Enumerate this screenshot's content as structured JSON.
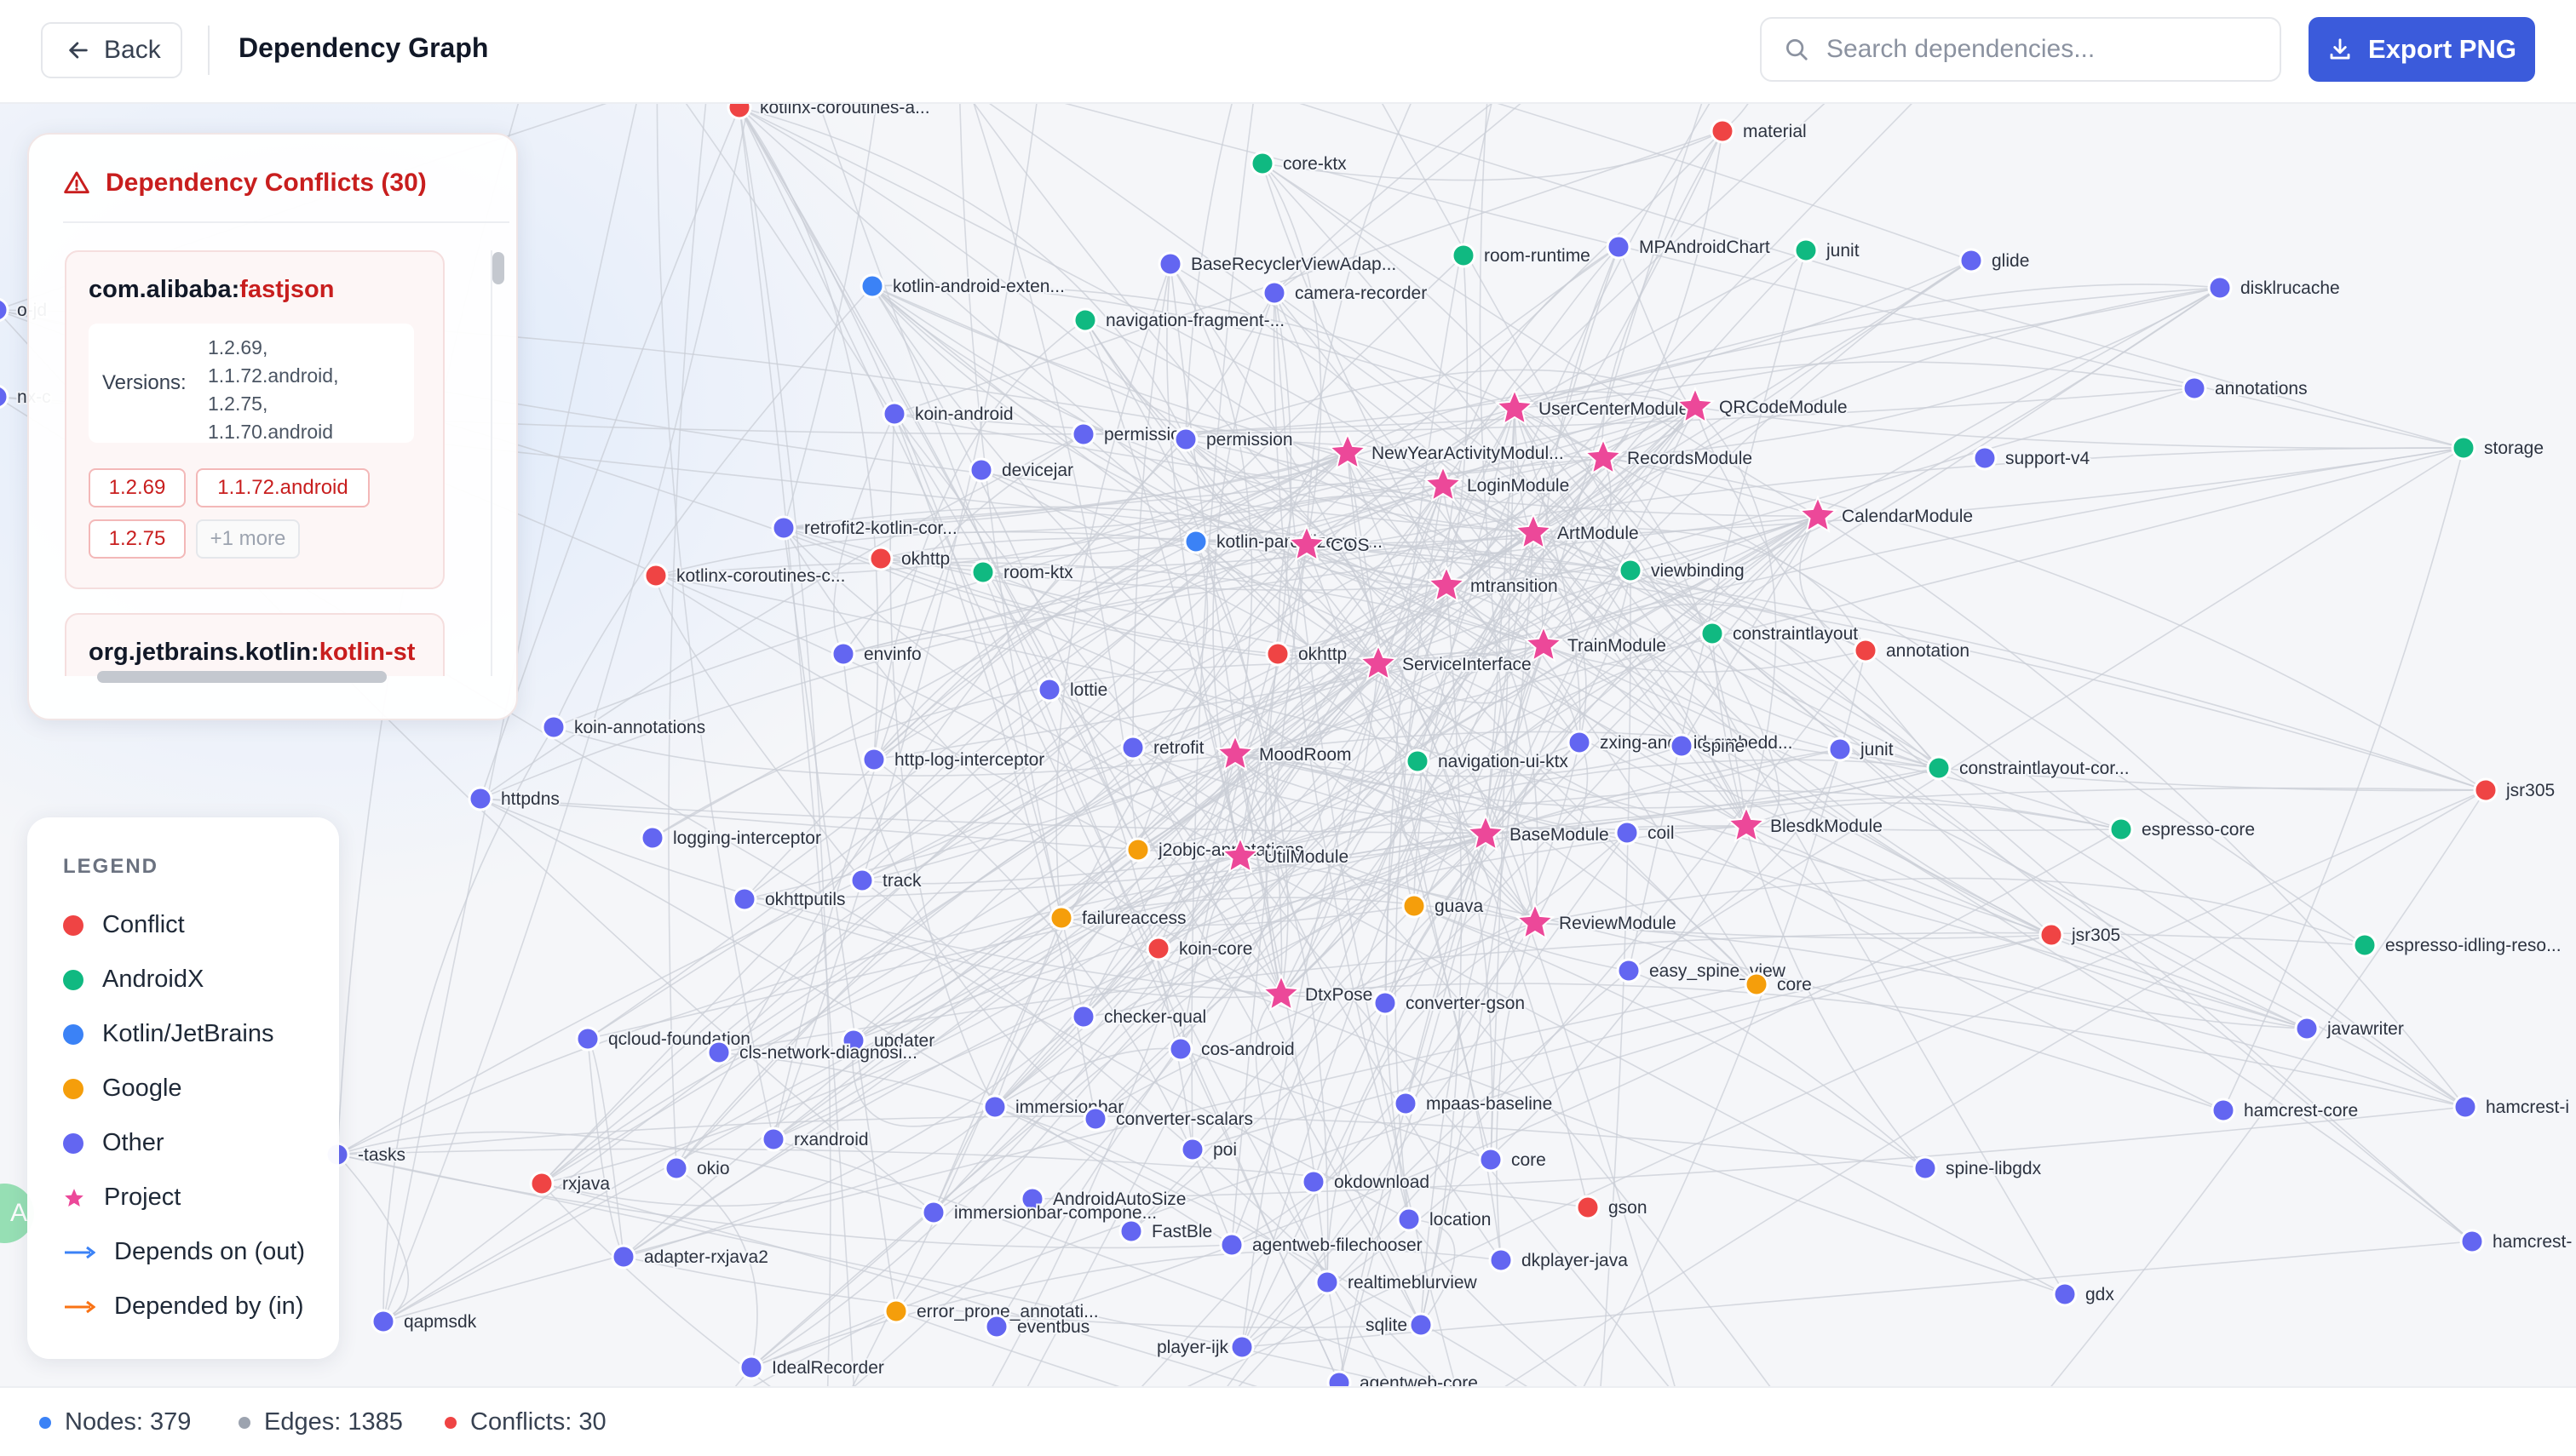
{
  "header": {
    "back_label": "Back",
    "title": "Dependency Graph",
    "search_placeholder": "Search dependencies...",
    "export_label": "Export PNG"
  },
  "colors": {
    "conflict": "#ef4444",
    "androidx": "#10b981",
    "kotlin": "#3b82f6",
    "google": "#f59e0b",
    "other": "#6366f1",
    "project": "#ec4899",
    "accent": "#3b5bdb"
  },
  "conflicts": {
    "title": "Dependency Conflicts (30)",
    "cards": [
      {
        "group": "com.alibaba:",
        "artifact": "fastjson",
        "versions_label": "Versions:",
        "versions": [
          "1.2.69,",
          "1.1.72.android,",
          "1.2.75,",
          "1.1.70.android"
        ],
        "chips": [
          "1.2.69",
          "1.1.72.android",
          "1.2.75"
        ],
        "more": "+1 more"
      },
      {
        "group": "org.jetbrains.kotlin:",
        "artifact": "kotlin-st"
      }
    ]
  },
  "legend": {
    "title": "LEGEND",
    "items": [
      {
        "kind": "dot",
        "color": "#ef4444",
        "label": "Conflict"
      },
      {
        "kind": "dot",
        "color": "#10b981",
        "label": "AndroidX"
      },
      {
        "kind": "dot",
        "color": "#3b82f6",
        "label": "Kotlin/JetBrains"
      },
      {
        "kind": "dot",
        "color": "#f59e0b",
        "label": "Google"
      },
      {
        "kind": "dot",
        "color": "#6366f1",
        "label": "Other"
      },
      {
        "kind": "star",
        "color": "#ec4899",
        "label": "Project"
      },
      {
        "kind": "arrow",
        "color": "#3b82f6",
        "label": "Depends on (out)"
      },
      {
        "kind": "arrow",
        "color": "#f97316",
        "label": "Depended by (in)"
      }
    ]
  },
  "status": {
    "nodes": "Nodes: 379",
    "edges": "Edges: 1385",
    "conflicts": "Conflicts: 30"
  },
  "side_bubble": "A",
  "graph": {
    "nodes": [
      {
        "label": "kotlinx-coroutines-a...",
        "type": "conflict"
      },
      {
        "label": "material",
        "type": "conflict"
      },
      {
        "label": "core-ktx",
        "type": "androidx"
      },
      {
        "label": "BaseRecyclerViewAdap...",
        "type": "other"
      },
      {
        "label": "room-runtime",
        "type": "androidx"
      },
      {
        "label": "MPAndroidChart",
        "type": "other"
      },
      {
        "label": "junit",
        "type": "androidx"
      },
      {
        "label": "glide",
        "type": "other"
      },
      {
        "label": "disklrucache",
        "type": "other"
      },
      {
        "label": "kotlin-android-exten...",
        "type": "kotlin"
      },
      {
        "label": "camera-recorder",
        "type": "other"
      },
      {
        "label": "navigation-fragment-...",
        "type": "androidx"
      },
      {
        "label": "annotations",
        "type": "other"
      },
      {
        "label": "storage",
        "type": "androidx"
      },
      {
        "label": "koin-android",
        "type": "other"
      },
      {
        "label": "UserCenterModule",
        "type": "project"
      },
      {
        "label": "QRCodeModule",
        "type": "project"
      },
      {
        "label": "permission",
        "type": "other"
      },
      {
        "label": "permission",
        "type": "other"
      },
      {
        "label": "NewYearActivityModul...",
        "type": "project"
      },
      {
        "label": "RecordsModule",
        "type": "project"
      },
      {
        "label": "support-v4",
        "type": "other"
      },
      {
        "label": "devicejar",
        "type": "other"
      },
      {
        "label": "LoginModule",
        "type": "project"
      },
      {
        "label": "CalendarModule",
        "type": "project"
      },
      {
        "label": "retrofit2-kotlin-cor...",
        "type": "other"
      },
      {
        "label": "ArtModule",
        "type": "project"
      },
      {
        "label": "kotlin-parcelize-run...",
        "type": "kotlin"
      },
      {
        "label": "COS",
        "type": "project"
      },
      {
        "label": "okhttp",
        "type": "conflict"
      },
      {
        "label": "kotlinx-coroutines-c...",
        "type": "conflict"
      },
      {
        "label": "room-ktx",
        "type": "androidx"
      },
      {
        "label": "viewbinding",
        "type": "androidx"
      },
      {
        "label": "mtransition",
        "type": "project"
      },
      {
        "label": "constraintlayout",
        "type": "androidx"
      },
      {
        "label": "envinfo",
        "type": "other"
      },
      {
        "label": "okhttp",
        "type": "conflict"
      },
      {
        "label": "ServiceInterface",
        "type": "project"
      },
      {
        "label": "TrainModule",
        "type": "project"
      },
      {
        "label": "annotation",
        "type": "conflict"
      },
      {
        "label": "lottie",
        "type": "other"
      },
      {
        "label": "koin-annotations",
        "type": "other"
      },
      {
        "label": "retrofit",
        "type": "other"
      },
      {
        "label": "MoodRoom",
        "type": "project"
      },
      {
        "label": "navigation-ui-ktx",
        "type": "androidx"
      },
      {
        "label": "zxing-android-embedd...",
        "type": "other"
      },
      {
        "label": "spine",
        "type": "other"
      },
      {
        "label": "junit",
        "type": "other"
      },
      {
        "label": "constraintlayout-cor...",
        "type": "androidx"
      },
      {
        "label": "http-log-interceptor",
        "type": "other"
      },
      {
        "label": "httpdns",
        "type": "other"
      },
      {
        "label": "jsr305",
        "type": "conflict"
      },
      {
        "label": "logging-interceptor",
        "type": "other"
      },
      {
        "label": "j2objc-annotations",
        "type": "google"
      },
      {
        "label": "UtilModule",
        "type": "project"
      },
      {
        "label": "BaseModule",
        "type": "project"
      },
      {
        "label": "coil",
        "type": "other"
      },
      {
        "label": "BlesdkModule",
        "type": "project"
      },
      {
        "label": "espresso-core",
        "type": "androidx"
      },
      {
        "label": "track",
        "type": "other"
      },
      {
        "label": "okhttputils",
        "type": "other"
      },
      {
        "label": "guava",
        "type": "google"
      },
      {
        "label": "failureaccess",
        "type": "google"
      },
      {
        "label": "ReviewModule",
        "type": "project"
      },
      {
        "label": "jsr305",
        "type": "conflict"
      },
      {
        "label": "espresso-idling-reso...",
        "type": "androidx"
      },
      {
        "label": "koin-core",
        "type": "conflict"
      },
      {
        "label": "easy_spine_view",
        "type": "other"
      },
      {
        "label": "core",
        "type": "google"
      },
      {
        "label": "DtxPose",
        "type": "project"
      },
      {
        "label": "converter-gson",
        "type": "other"
      },
      {
        "label": "checker-qual",
        "type": "other"
      },
      {
        "label": "javawriter",
        "type": "other"
      },
      {
        "label": "qcloud-foundation",
        "type": "other"
      },
      {
        "label": "updater",
        "type": "other"
      },
      {
        "label": "cls-network-diagnosi...",
        "type": "other"
      },
      {
        "label": "cos-android",
        "type": "other"
      },
      {
        "label": "immersionbar",
        "type": "other"
      },
      {
        "label": "mpaas-baseline",
        "type": "other"
      },
      {
        "label": "converter-scalars",
        "type": "other"
      },
      {
        "label": "hamcrest-core",
        "type": "other"
      },
      {
        "label": "hamcrest-i",
        "type": "other"
      },
      {
        "label": "-tasks",
        "type": "other"
      },
      {
        "label": "rxandroid",
        "type": "other"
      },
      {
        "label": "poi",
        "type": "other"
      },
      {
        "label": "core",
        "type": "other"
      },
      {
        "label": "rxjava",
        "type": "conflict"
      },
      {
        "label": "okio",
        "type": "other"
      },
      {
        "label": "okdownload",
        "type": "other"
      },
      {
        "label": "spine-libgdx",
        "type": "other"
      },
      {
        "label": "AndroidAutoSize",
        "type": "other"
      },
      {
        "label": "immersionbar-compone...",
        "type": "other"
      },
      {
        "label": "location",
        "type": "other"
      },
      {
        "label": "gson",
        "type": "conflict"
      },
      {
        "label": "FastBle",
        "type": "other"
      },
      {
        "label": "agentweb-filechooser",
        "type": "other"
      },
      {
        "label": "hamcrest-",
        "type": "other"
      },
      {
        "label": "adapter-rxjava2",
        "type": "other"
      },
      {
        "label": "dkplayer-java",
        "type": "other"
      },
      {
        "label": "realtimeblurview",
        "type": "other"
      },
      {
        "label": "gdx",
        "type": "other"
      },
      {
        "label": "qapmsdk",
        "type": "other"
      },
      {
        "label": "error_prone_annotati...",
        "type": "google"
      },
      {
        "label": "eventbus",
        "type": "other"
      },
      {
        "label": "sqlite",
        "type": "other"
      },
      {
        "label": "player-ijk",
        "type": "other"
      },
      {
        "label": "IdealRecorder",
        "type": "other"
      },
      {
        "label": "agentweb-core",
        "type": "other"
      },
      {
        "label": "o-jd",
        "type": "other"
      },
      {
        "label": "nx-c",
        "type": "other"
      }
    ]
  }
}
